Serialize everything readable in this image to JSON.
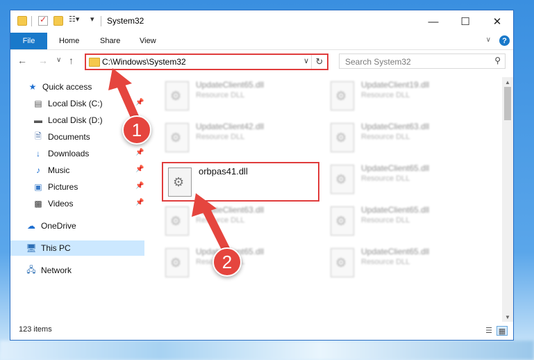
{
  "window": {
    "title": "System32"
  },
  "ribbon": {
    "file": "File",
    "tabs": [
      "Home",
      "Share",
      "View"
    ],
    "help": "?"
  },
  "address": {
    "path": "C:\\Windows\\System32"
  },
  "search": {
    "placeholder": "Search System32"
  },
  "nav": {
    "items": [
      {
        "label": "Quick access",
        "icon": "star-icon",
        "pinned": false
      },
      {
        "label": "Local Disk (C:)",
        "icon": "drive-icon",
        "pinned": true
      },
      {
        "label": "Local Disk (D:)",
        "icon": "drive-icon",
        "pinned": false
      },
      {
        "label": "Documents",
        "icon": "documents-icon",
        "pinned": false
      },
      {
        "label": "Downloads",
        "icon": "downloads-icon",
        "pinned": true
      },
      {
        "label": "Music",
        "icon": "music-icon",
        "pinned": true
      },
      {
        "label": "Pictures",
        "icon": "pictures-icon",
        "pinned": true
      },
      {
        "label": "Videos",
        "icon": "videos-icon",
        "pinned": true
      },
      {
        "label": "OneDrive",
        "icon": "cloud-icon",
        "pinned": false
      },
      {
        "label": "This PC",
        "icon": "computer-icon",
        "pinned": false,
        "selected": true
      },
      {
        "label": "Network",
        "icon": "network-icon",
        "pinned": false
      }
    ]
  },
  "files": [
    {
      "name": "UpdateClient65.dll",
      "type": "Resource DLL"
    },
    {
      "name": "UpdateClient19.dll",
      "type": "Resource DLL"
    },
    {
      "name": "UpdateClient42.dll",
      "type": "Resource DLL"
    },
    {
      "name": "UpdateClient63.dll",
      "type": "Resource DLL"
    },
    {
      "name": "orbpas41.dll",
      "type": ""
    },
    {
      "name": "UpdateClient65.dll",
      "type": "Resource DLL"
    },
    {
      "name": "UpdateClient63.dll",
      "type": "Resource DLL"
    },
    {
      "name": "UpdateClient65.dll",
      "type": "Resource DLL"
    },
    {
      "name": "UpdateClient65.dll",
      "type": "Resource DLL"
    },
    {
      "name": "UpdateClient65.dll",
      "type": "Resource DLL"
    }
  ],
  "status": {
    "count": "123 items"
  },
  "annotations": {
    "step1": "1",
    "step2": "2",
    "color": "#e03c3c"
  }
}
